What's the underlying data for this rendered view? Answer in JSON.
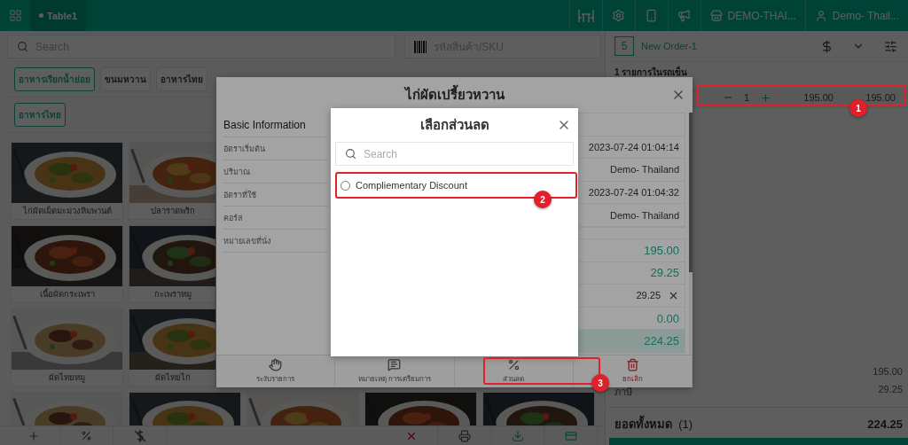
{
  "top_bar": {
    "tabs": [
      {
        "label": "Table1",
        "selected": true
      }
    ],
    "store": {
      "label": "DEMO-THAI..."
    },
    "user": {
      "label": "Demo- Thail..."
    }
  },
  "search": {
    "placeholder": "Search"
  },
  "sku_field": {
    "placeholder": "รหัสสินค้า/SKU"
  },
  "category_rows": [
    [
      {
        "label": "อาหารเรียกน้ำย่อย",
        "selected": true
      },
      {
        "label": "ขนมหวาน",
        "selected": false
      },
      {
        "label": "อาหารไทย",
        "selected": false
      }
    ],
    [
      {
        "label": "อาหารไทย",
        "selected": true
      }
    ]
  ],
  "product_rows": [
    [
      {
        "kind": "dish",
        "name": "ไก่ผัดเม็ดมะม่วงหิมพานต์"
      },
      {
        "kind": "dish",
        "name": "ปลาราดพริก"
      }
    ],
    [
      {
        "kind": "dish",
        "name": "เนื้อผัดกระเพรา"
      },
      {
        "kind": "dish",
        "name": "กะเพราหมู"
      }
    ],
    [
      {
        "kind": "dish",
        "name": "ผัดไทยหมู"
      },
      {
        "kind": "dish",
        "name": "ผัดไทยไก่"
      }
    ],
    [
      {
        "kind": "picture"
      },
      {
        "kind": "picture"
      },
      {
        "kind": "picture"
      },
      {
        "kind": "picture"
      },
      {
        "kind": "picture"
      }
    ]
  ],
  "order": {
    "count": "5",
    "title": "New Order-1",
    "cart_label": "1 รายการในรถเข็น",
    "items": [
      {
        "qty": "1",
        "price": "195.00",
        "total": "195.00"
      }
    ],
    "subtotal": "195.00",
    "tax_label": "ภาษี",
    "tax": "29.25",
    "total_label": "ยอดทั้งหมด",
    "total_count": "(1)",
    "total": "224.25"
  },
  "item_dialog": {
    "title": "ไก่ผัดเปรี้ยวหวาน",
    "section": "Basic Information",
    "fields": [
      "อัตราเริ่มต้น",
      "ปริมาณ",
      "อัตราที่ใช้",
      "คอร์ส",
      "หมายเลขที่นั่ง"
    ],
    "details": [
      "2023-07-24 01:04:14",
      "Demo- Thailand",
      "2023-07-24 01:04:32",
      "Demo- Thailand"
    ],
    "amounts": [
      {
        "kind": "amount",
        "value": "195.00"
      },
      {
        "kind": "amount",
        "value": "29.25"
      },
      {
        "kind": "removable",
        "value": "29.25"
      },
      {
        "kind": "amount",
        "value": "0.00"
      },
      {
        "kind": "total",
        "value": "224.25"
      }
    ],
    "actions": [
      {
        "kind": "hold",
        "label": "ระงับรายการ"
      },
      {
        "kind": "note",
        "label": "หมายเหตุ การเตรียมการ"
      },
      {
        "kind": "discount",
        "label": "ส่วนลด"
      },
      {
        "kind": "cancel",
        "label": "ยกเลิก"
      }
    ]
  },
  "discount_dialog": {
    "title": "เลือกส่วนลด",
    "search": {
      "placeholder": "Search"
    },
    "options": [
      {
        "label": "Compliementary Discount",
        "selected": false
      }
    ]
  },
  "annotations": [
    {
      "label": "1"
    },
    {
      "label": "2"
    },
    {
      "label": "3"
    }
  ]
}
